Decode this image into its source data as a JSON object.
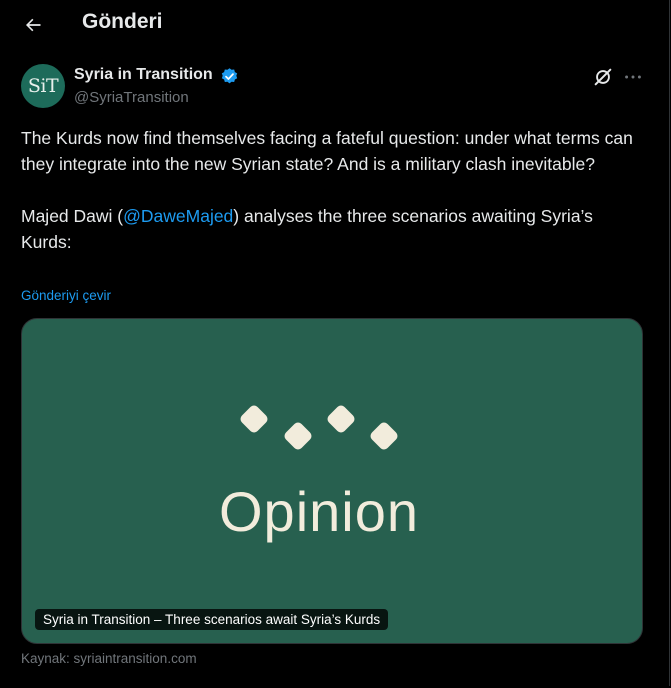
{
  "header": {
    "back_icon": "arrow-left-icon",
    "title": "Gönderi"
  },
  "author": {
    "avatar_text": "SiT",
    "name": "Syria in Transition",
    "handle": "@SyriaTransition",
    "verified_icon": "verified-badge-icon",
    "verified_color": "#1d9bf0"
  },
  "actions": {
    "grok_icon": "grok-icon",
    "more_icon": "more-options-icon"
  },
  "tweet": {
    "paragraph1": "The Kurds now find themselves facing a fateful question: under what terms can they integrate into the new Syrian state? And is a military clash inevitable?",
    "paragraph2_before": "Majed Dawi (",
    "mention": "@DaweMajed",
    "paragraph2_after": ") analyses the three scenarios awaiting Syria’s Kurds:",
    "translate_link": "Gönderiyi çevir"
  },
  "card": {
    "background_color": "#27604f",
    "image_text": "Opinion",
    "caption": "Syria in Transition – Three scenarios await Syria’s Kurds",
    "source": "Kaynak: syriaintransition.com"
  },
  "colors": {
    "accent": "#1d9bf0",
    "background": "#000000",
    "muted": "#71767b"
  }
}
